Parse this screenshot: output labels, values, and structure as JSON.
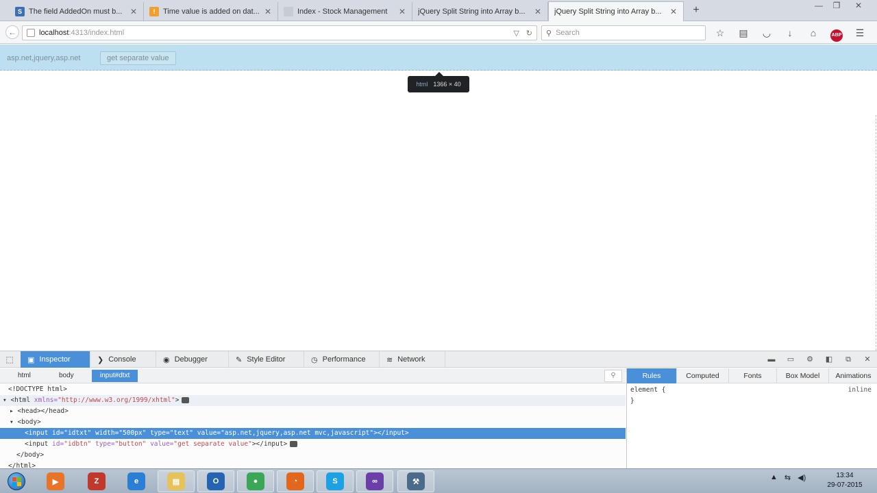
{
  "window": {
    "tabs": [
      {
        "title": "The field AddedOn must b...",
        "favicon_letter": "S",
        "favicon_color": "#3d6fb6"
      },
      {
        "title": "Time value is added on dat...",
        "favicon_letter": "!",
        "favicon_color": "#f0a030"
      },
      {
        "title": "Index - Stock Management",
        "favicon_letter": "",
        "favicon_color": "#c7ccd3"
      },
      {
        "title": "jQuery Split String into Array b...",
        "favicon_letter": "",
        "favicon_color": "#c7ccd3"
      },
      {
        "title": "jQuery Split String into Array b...",
        "favicon_letter": "",
        "favicon_color": "#c7ccd3",
        "active": true
      }
    ],
    "new_tab_label": "+",
    "controls": [
      "—",
      "❐",
      "✕"
    ]
  },
  "navbar": {
    "url_host": "localhost",
    "url_rest": ":4313/index.html",
    "search_placeholder": "Search"
  },
  "page": {
    "text": "asp.net,jquery,asp.net",
    "button_label": "get separate value",
    "tooltip_tag": "html",
    "tooltip_size": "1366 × 40"
  },
  "devtools": {
    "tabs": [
      "Inspector",
      "Console",
      "Debugger",
      "Style Editor",
      "Performance",
      "Network"
    ],
    "tab_icons": [
      "▣",
      "❯",
      "◉",
      "✎",
      "◷",
      "≋"
    ],
    "breadcrumbs": [
      "html",
      "body",
      "input#dtxt"
    ],
    "markup_lines": {
      "doctype": "<!DOCTYPE html>",
      "html_open_tag": "<html ",
      "html_attr": "xmlns=",
      "html_val": "\"http://www.w3.org/1999/xhtml\"",
      "html_close": ">",
      "head": "<head></head>",
      "body_open": "<body>",
      "input1_open": "<input ",
      "input1_attrs": [
        {
          "name": "id=",
          "value": "\"idtxt\" "
        },
        {
          "name": "width=",
          "value": "\"500px\" "
        },
        {
          "name": "type=",
          "value": "\"text\" "
        },
        {
          "name": "value=",
          "value": "\"asp.net,jquery,asp.net mvc,javascript\""
        }
      ],
      "input1_close": "></input>",
      "input2_open": "<input ",
      "input2_attrs": [
        {
          "name": "id=",
          "value": "\"idbtn\" "
        },
        {
          "name": "type=",
          "value": "\"button\" "
        },
        {
          "name": "value=",
          "value": "\"get separate value\""
        }
      ],
      "input2_close": "></input>",
      "body_close": "</body>",
      "html_close_tag": "</html>"
    },
    "side_tabs": [
      "Rules",
      "Computed",
      "Fonts",
      "Box Model",
      "Animations"
    ],
    "rule_selector": "element {",
    "rule_close": "}",
    "rule_source": "inline"
  },
  "taskbar": {
    "apps": [
      {
        "name": "media-player-icon",
        "color": "#e8742a",
        "glyph": "▶"
      },
      {
        "name": "filezilla-icon",
        "color": "#c0392b",
        "glyph": "Z"
      },
      {
        "name": "internet-explorer-icon",
        "color": "#2a7fd4",
        "glyph": "e"
      },
      {
        "name": "file-explorer-icon",
        "color": "#e6c25a",
        "glyph": "▤"
      },
      {
        "name": "outlook-icon",
        "color": "#2464b0",
        "glyph": "O"
      },
      {
        "name": "chrome-icon",
        "color": "#3aa757",
        "glyph": "●"
      },
      {
        "name": "firefox-icon",
        "color": "#e2661e",
        "glyph": "◔"
      },
      {
        "name": "skype-icon",
        "color": "#1da1e2",
        "glyph": "S"
      },
      {
        "name": "visual-studio-icon",
        "color": "#6c3fa8",
        "glyph": "∞"
      },
      {
        "name": "tool-icon",
        "color": "#4a6b8a",
        "glyph": "⚒"
      }
    ],
    "time": "13:34",
    "date": "29-07-2015"
  }
}
